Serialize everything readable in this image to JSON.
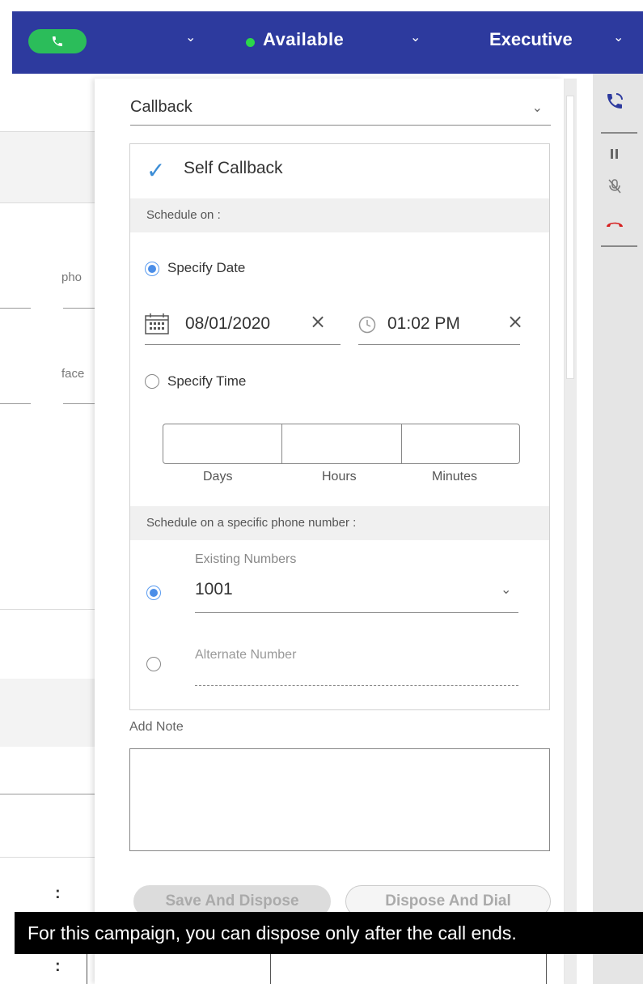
{
  "topbar": {
    "status": "Available",
    "role": "Executive",
    "accent_color": "#2d3a9e",
    "call_button_color": "#2bbd5a",
    "status_dot_color": "#2bd64a",
    "icons": [
      "phone-icon",
      "chevron-down-icon"
    ]
  },
  "background_form": {
    "field_labels": [
      "pho",
      "face"
    ]
  },
  "panel": {
    "disposition": "Callback",
    "self_callback": "Self Callback",
    "schedule_on": "Schedule on :",
    "specify_date": "Specify Date",
    "date": "08/01/2020",
    "time": "01:02 PM",
    "specify_time": "Specify Time",
    "duration_labels": [
      "Days",
      "Hours",
      "Minutes"
    ],
    "schedule_phone": "Schedule on a specific phone number :",
    "existing_numbers": "Existing Numbers",
    "selected_number": "1001",
    "alternate_number": "Alternate Number",
    "add_note": "Add Note",
    "save_button": "Save And Dispose",
    "dial_button": "Dispose And Dial",
    "schedule_mode": "Specify Date",
    "number_mode": "Existing Numbers"
  },
  "right_strip": {
    "icons": [
      "callback-phone-icon",
      "pause-icon",
      "mute-mic-icon",
      "hangup-icon"
    ],
    "hangup_color": "#d62020"
  },
  "tooltip": {
    "text": "For this campaign, you can dispose only after the call ends."
  }
}
